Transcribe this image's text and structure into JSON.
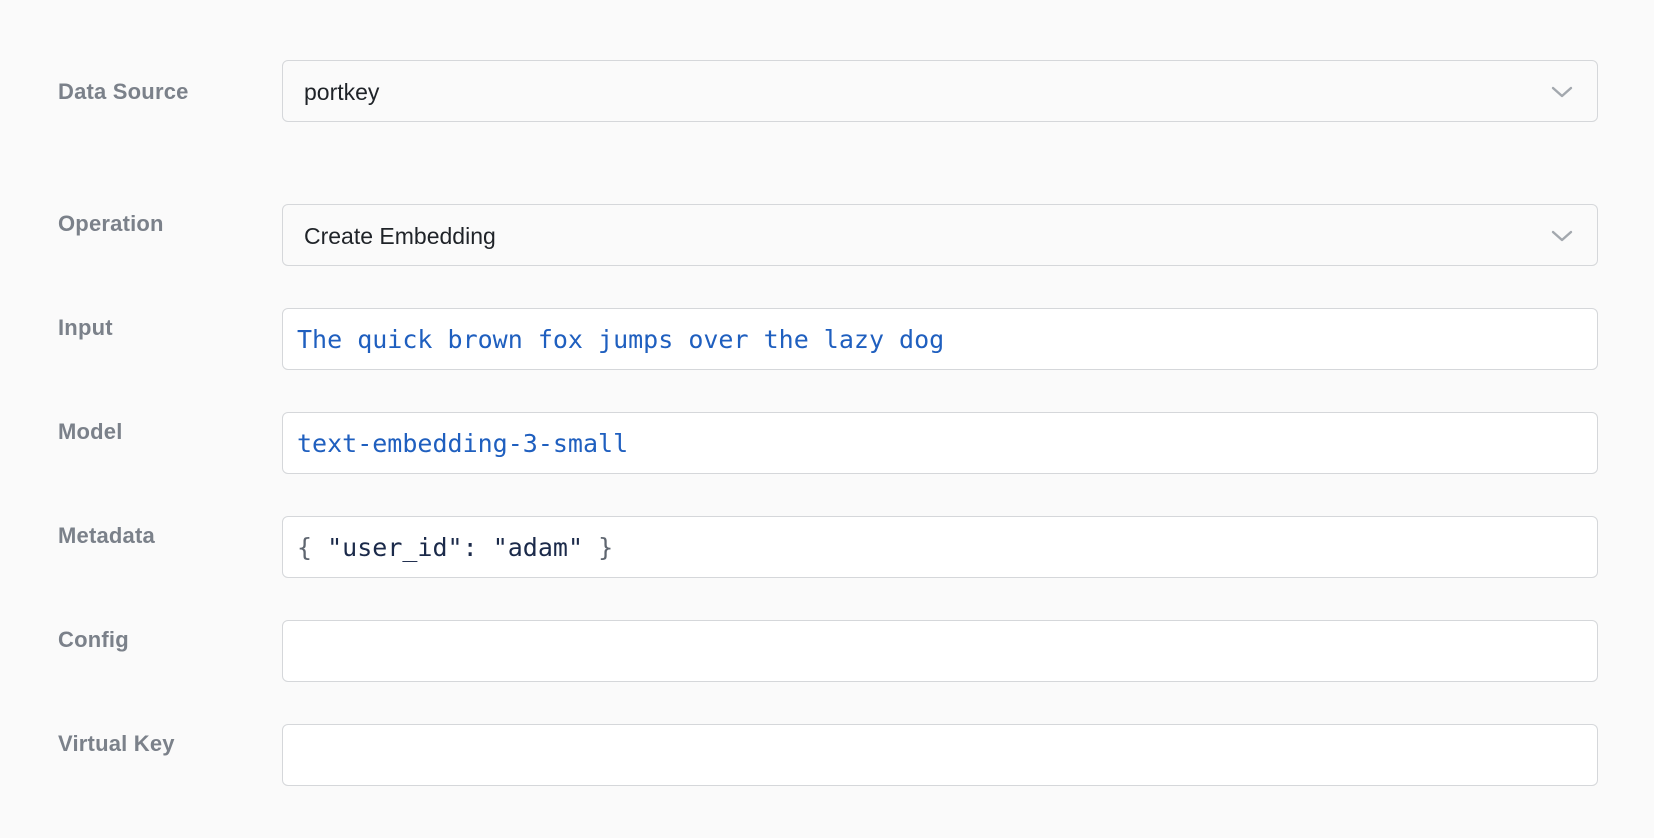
{
  "form": {
    "data_source": {
      "label": "Data Source",
      "value": "portkey",
      "icon": "chevron-down-icon"
    },
    "operation": {
      "label": "Operation",
      "value": "Create Embedding",
      "icon": "chevron-down-icon"
    },
    "input": {
      "label": "Input",
      "value": "The quick brown fox jumps over the lazy dog"
    },
    "model": {
      "label": "Model",
      "value": "text-embedding-3-small"
    },
    "metadata": {
      "label": "Metadata",
      "open_brace": "{",
      "value": "\"user_id\": \"adam\"",
      "close_brace": "}"
    },
    "config": {
      "label": "Config",
      "value": ""
    },
    "virtual_key": {
      "label": "Virtual Key",
      "value": ""
    }
  },
  "colors": {
    "background": "#fafafa",
    "label": "#7b818a",
    "border": "#d5d7da",
    "code_value": "#1f5fbf",
    "json_text": "#1b2a4a"
  }
}
